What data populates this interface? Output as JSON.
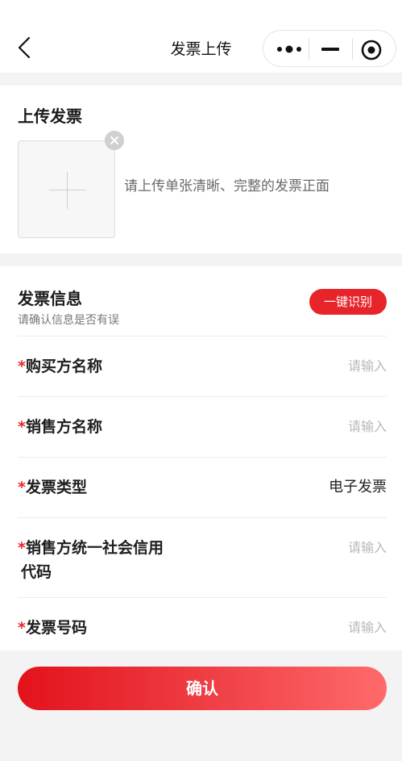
{
  "navbar": {
    "title": "发票上传"
  },
  "upload": {
    "title": "上传发票",
    "hint": "请上传单张清晰、完整的发票正面"
  },
  "info": {
    "title": "发票信息",
    "subtitle": "请确认信息是否有误",
    "ocr_label": "一键识别",
    "fields": [
      {
        "star": "*",
        "label": "购买方名称",
        "value": "请输入"
      },
      {
        "star": "*",
        "label": "销售方名称",
        "value": "请输入"
      },
      {
        "star": "*",
        "label": "发票类型",
        "value": "电子发票"
      },
      {
        "star": "*",
        "label": "销售方统一社会信用",
        "label2": "代码",
        "value": "请输入"
      },
      {
        "star": "*",
        "label": "发票号码",
        "value": "请输入"
      }
    ]
  },
  "confirm_label": "确认",
  "colors": {
    "accent": "#e8242b",
    "background": "#f3f3f3"
  }
}
